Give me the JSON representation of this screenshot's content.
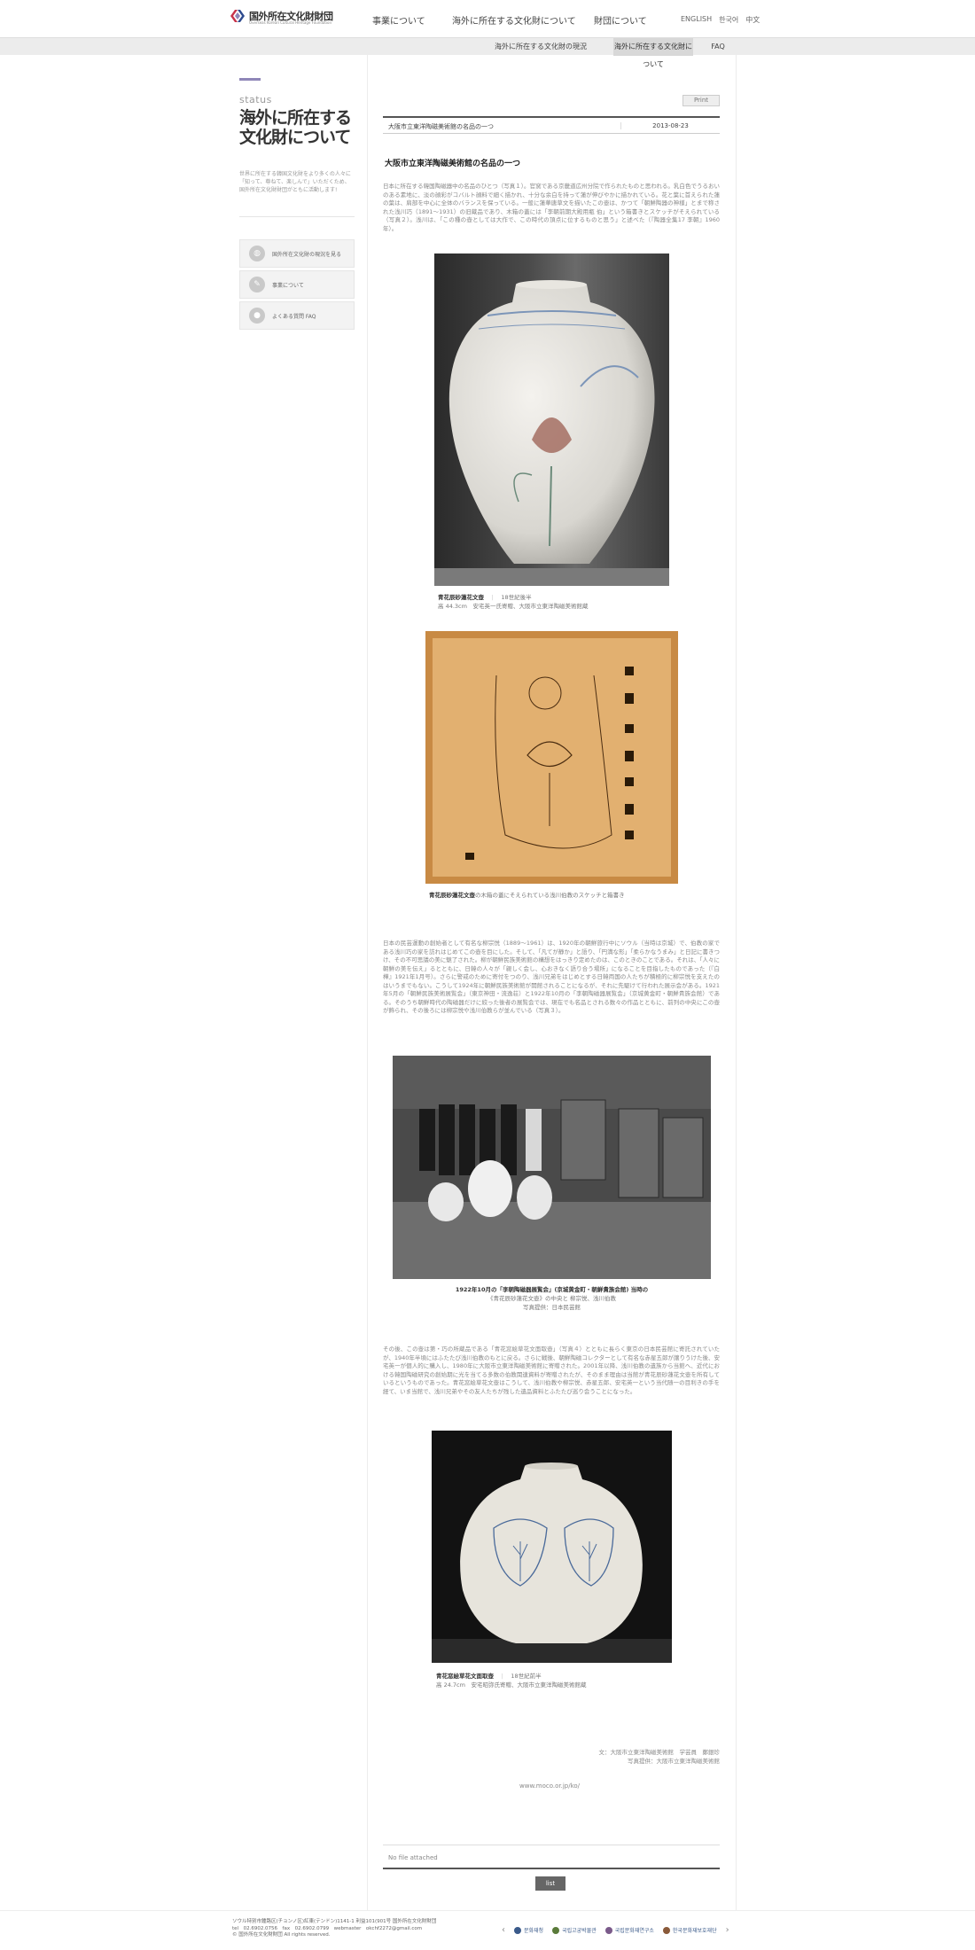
{
  "header": {
    "logo_text": "国外所在文化財財団",
    "logo_sub": "Overseas Korean Cultural Heritage Foundation",
    "nav": [
      "事業について",
      "海外に所在する文化財について",
      "財団について"
    ],
    "lang": [
      "ENGLISH",
      "한국어",
      "中文"
    ]
  },
  "subnav": [
    "海外に所在する文化財の現況",
    "海外に所在する文化財について",
    "FAQ"
  ],
  "sidebar": {
    "status": "status",
    "title": "海外に所在する文化財について",
    "desc": "世界に所在する韓国文化財をより多くの人々に「知って、尊ねて、楽しんで」いただくため、国外所在文化財財団がともに活動します!",
    "menu": [
      "国外所在文化財の現況を見る",
      "事業について",
      "よくある質問 FAQ"
    ]
  },
  "article": {
    "print": "Print",
    "board_title": "大阪市立東洋陶磁美術館の名品の一つ",
    "date": "2013-08-23",
    "title": "大阪市立東洋陶磁美術館の名品の一つ",
    "p1": "日本に所在する韓国陶磁器中の名品のひとつ（写真１）。官窯である京畿道広州分院で作られたものと思われる。乳白色でうるおいのある素地に、淡の顔彩がコバルト顔料で細く描かれ、十分な余白を持って蓮が伸びやかに描かれている。花と葉に首えられた蓮の葉は、肩部を中心に全体のバランスを保っている。一般に蓮華唐草文を描いたこの壺は、かつて「朝鮮陶器の神様」とまで称された浅川巧（1891～1931）の旧蔵品であり、木箱の蓋には「李朝前期大殿用瓶 伯」という箱書きとスケッチがそえられている（写真２）。浅川は、「この種の壺としては大作で、この時代の頂点に位するものと思う」と述べた（『陶器全集17 李朝』1960年）。",
    "fig1_caption_title": "青花辰砂蓮花文壺",
    "fig1_caption_era": "18世紀後半",
    "fig1_caption_detail": "高 44.3cm　安宅英一氏寄贈、大阪市立東洋陶磁美術館蔵",
    "fig2_caption_title": "青花辰砂蓮花文壺",
    "fig2_caption_rest": "の木箱の蓋にそえられている浅川伯教のスケッチと箱書き",
    "p2": "日本の民芸運動の創始者として有名な柳宗悦（1889～1961）は、1920年の朝鮮旅行中にソウル（当時は京城）で、伯教の家である浅川巧の家を訪れはじめてこの壺を目にした。そして、「凡てが静か」と語り、「円満な形」「柔らかなうまみ」と日記に書きつけ、その不可思議の美に魅了された。柳が朝鮮民族美術館の構想をはっきり定めたのは、このときのことである。それは、「人々に朝鮮の美を伝え」るとともに、日韓の人々が「親しく会し、心おきなく語り合う場所」になることを目指したものであった（『白樺』1921年1月号）。さらに警戒のために寄付をつのり、浅川兄弟をはじめとする日韓両国の人たちが積極的に柳宗悦を支えたのはいうまでもない。こうして1924年に朝鮮民族美術館が開館されることになるが、それに先駆けて行われた展示会がある。1921年5月の「朝鮮民族美術展覧会」（東京神田・流逸荘）と1922年10月の「李朝陶磁器展覧会」（京城黄金町・朝鮮貴族会館）である。そのうち朝鮮時代の陶磁器だけに絞った後者の展覧会では、現在でも名品とされる数々の作品とともに、前列の中央にこの壺が飾られ、その後ろには柳宗悦や浅川伯教らが並んでいる（写真３）。",
    "fig3_caption_title": "1922年10月の「李朝陶磁器展覧会」(京城黄金町・朝鮮貴族会館) 当時の",
    "fig3_caption_line2": "《青花辰砂蓮花文壺》の中央と 柳宗悦、浅川伯教",
    "fig3_caption_line3": "写真提供：日本民芸館",
    "p3": "その後、この壺は第・巧の所蔵品である「青花窓絵草花文面取壺」（写真４）とともに長らく東京の日本民芸館に寄託されていたが、1940年半頃にはふたたび浅川伯教のもとに戻る。さらに戦後、朝鮮陶磁コレクターとして有名な赤星五郎が譲りうけた後、安宅英一が個人的に購入し、1980年に大阪市立東洋陶磁美術館に寄贈された。2001年以降、浅川伯教の遺族から当館へ、近代における韓国陶磁研究の創始期に光を当てる多数の伯教関連資料が寄贈されたが、そのまま理由は当館が青花辰砂蓮花文壺を所有しているというものであった。青花窓絵草花文壺はこうして、浅川伯教や柳宗悦、赤星五郎、安宅英一という当代随一の目利きの手を経て、いま当館で、浅川兄弟やその友人たちが残した遺品資料とふたたび巡り会うことになった。",
    "fig4_caption_title": "青花窓絵草花文面取壺",
    "fig4_caption_era": "18世紀前半",
    "fig4_caption_detail": "高 24.7cm　安宅昭弥氏寄贈、大阪市立東洋陶磁美術館蔵",
    "credit_line1": "文：大阪市立東洋陶磁美術館　学芸員　鄭銀珍",
    "credit_line2": "写真提供：大阪市立東洋陶磁美術館",
    "url": "www.moco.or.jp/ko/",
    "attach": "No file attached",
    "list_button": "list"
  },
  "footer": {
    "line1": "ソウル特別市鍾路区(チョンノ区)紅東(テンドン)1141-1 利益101(901号 国外所在文化財財団",
    "line2": "tel　02.6902.0756　fax　02.6902.0799　webmaster　okchf2272@gmail.com",
    "line3": "© 国外所在文化財財団 All rights reserved.",
    "logos": [
      "문화재청",
      "국립고궁박물관",
      "국립문화재연구소",
      "한국문화재보호재단"
    ]
  },
  "colors": {
    "accent": "#8f86b8",
    "dark_line": "#555555"
  }
}
